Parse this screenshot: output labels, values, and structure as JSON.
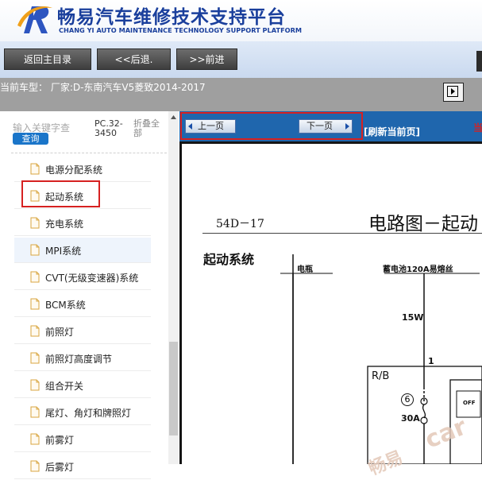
{
  "header": {
    "title": "畅易汽车维修技术支持平台",
    "subtitle": "CHANG YI AUTO MAINTENANCE TECHNOLOGY SUPPORT PLATFORM",
    "logo_icon": "r-swoosh-logo-icon"
  },
  "nav": {
    "home": "返回主目录",
    "back": "<<后退.",
    "forward": ">>前进"
  },
  "car_bar": {
    "text": "当前车型： 厂家:D-东南汽车V5菱致2014-2017"
  },
  "sidebar": {
    "search_placeholder": "输入关键字查",
    "search_button": "查询",
    "pc_number": "PC.32-3450",
    "collapse_all": "折叠全部",
    "items": [
      {
        "label": "电源分配系统"
      },
      {
        "label": "起动系统"
      },
      {
        "label": "充电系统"
      },
      {
        "label": "MPI系统"
      },
      {
        "label": "CVT(无级变速器)系统"
      },
      {
        "label": "BCM系统"
      },
      {
        "label": "前照灯"
      },
      {
        "label": "前照灯高度调节"
      },
      {
        "label": "组合开关"
      },
      {
        "label": "尾灯、角灯和牌照灯"
      },
      {
        "label": "前雾灯"
      },
      {
        "label": "后雾灯"
      }
    ]
  },
  "content": {
    "prev_page": "上一页",
    "next_page": "下一页",
    "refresh": "[刷新当前页]",
    "edge_text": "当",
    "document": {
      "page_number": "54D－17",
      "title": "电路图－起动",
      "section": "起动系统",
      "label_battery": "电瓶",
      "label_fuse": "蓄电池120A易熔丝",
      "label_15w": "15W",
      "label_1": "1",
      "label_rb": "R/B",
      "label_6": "6",
      "label_30a": "30A",
      "label_off": "OFF",
      "watermark_1": "car",
      "watermark_2": "畅易"
    }
  },
  "colors": {
    "brand_blue": "#1a3f9c",
    "content_bar": "#1f66ad",
    "highlight_red": "#d62121"
  }
}
